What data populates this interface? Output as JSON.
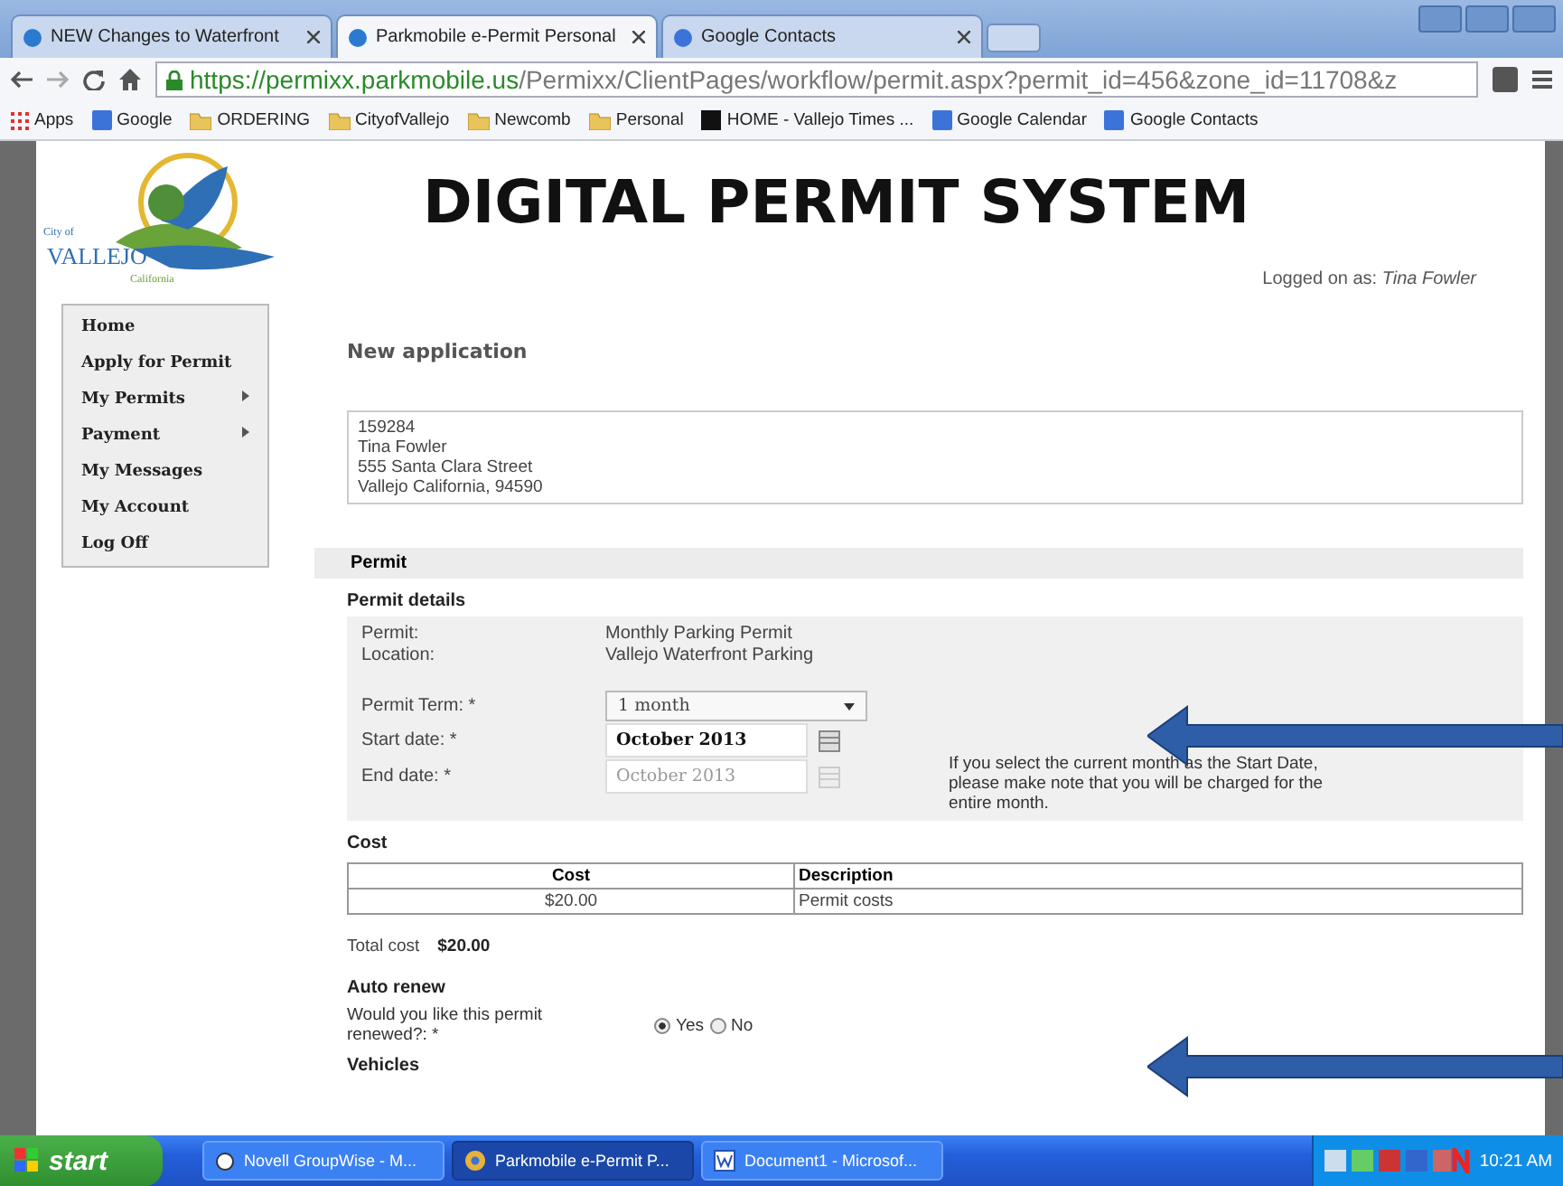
{
  "browser": {
    "tabs": [
      {
        "title": "NEW Changes to Waterfront",
        "selected": false
      },
      {
        "title": "Parkmobile e-Permit Personal",
        "selected": true
      },
      {
        "title": "Google Contacts",
        "selected": false
      }
    ],
    "url_host": "https://permixx.parkmobile.us",
    "url_path": "/Permixx/ClientPages/workflow/permit.aspx?permit_id=456&zone_id=11708&z",
    "bookmarks": [
      {
        "label": "Apps",
        "kind": "apps"
      },
      {
        "label": "Google",
        "kind": "site"
      },
      {
        "label": "ORDERING",
        "kind": "folder"
      },
      {
        "label": "CityofVallejo",
        "kind": "folder"
      },
      {
        "label": "Newcomb",
        "kind": "folder"
      },
      {
        "label": "Personal",
        "kind": "folder"
      },
      {
        "label": "HOME - Vallejo Times ...",
        "kind": "th"
      },
      {
        "label": "Google Calendar",
        "kind": "site"
      },
      {
        "label": "Google Contacts",
        "kind": "site"
      }
    ]
  },
  "page": {
    "logo": {
      "city_of": "City of",
      "name": "VALLEJO",
      "state": "California"
    },
    "title": "DIGITAL PERMIT SYSTEM",
    "menu": [
      {
        "label": "Home",
        "submenu": false
      },
      {
        "label": "Apply for Permit",
        "submenu": false
      },
      {
        "label": "My Permits",
        "submenu": true
      },
      {
        "label": "Payment",
        "submenu": true
      },
      {
        "label": "My Messages",
        "submenu": false
      },
      {
        "label": "My Account",
        "submenu": false
      },
      {
        "label": "Log Off",
        "submenu": false
      }
    ],
    "logged_on_label": "Logged on as:",
    "logged_on_user": "Tina Fowler",
    "heading": "New application",
    "address": [
      "159284",
      "Tina Fowler",
      "555 Santa Clara Street",
      "Vallejo California, 94590"
    ],
    "section": "Permit",
    "details_title": "Permit details",
    "details": [
      {
        "label": "Permit:",
        "value": "Monthly Parking Permit"
      },
      {
        "label": "Location:",
        "value": "Vallejo Waterfront Parking"
      }
    ],
    "term": {
      "label": "Permit Term: *",
      "value": "1 month"
    },
    "start": {
      "label": "Start date: *",
      "value": "October 2013",
      "disabled": false
    },
    "end": {
      "label": "End date: *",
      "value": "October 2013",
      "disabled": true
    },
    "note": "If you select the current month as the Start Date, please make note that you will be charged for the entire month.",
    "cost_title": "Cost",
    "cost_columns": [
      "Cost",
      "Description"
    ],
    "cost_rows": [
      [
        "$20.00",
        "Permit costs"
      ]
    ],
    "total_label": "Total cost",
    "total_value": "$20.00",
    "renew_title": "Auto renew",
    "renew_question": "Would you like this permit renewed?: *",
    "renew_options": [
      {
        "label": "Yes",
        "selected": true
      },
      {
        "label": "No",
        "selected": false
      }
    ],
    "vehicles_title": "Vehicles"
  },
  "taskbar": {
    "start": "start",
    "items": [
      {
        "label": "Novell GroupWise - M...",
        "selected": false,
        "kind": "gw"
      },
      {
        "label": "Parkmobile e-Permit P...",
        "selected": true,
        "kind": "chrome"
      },
      {
        "label": "Document1 - Microsof...",
        "selected": false,
        "kind": "word"
      }
    ],
    "clock": "10:21 AM"
  }
}
